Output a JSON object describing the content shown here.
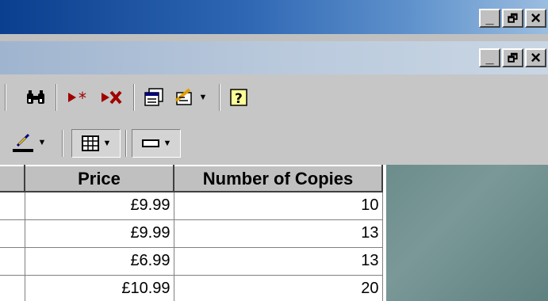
{
  "window": {
    "app_caption": {
      "minimize": "_",
      "restore": "🗗",
      "close": "×"
    },
    "doc_caption": {
      "minimize": "_",
      "restore": "🗗",
      "close": "×"
    }
  },
  "toolbar_standard": {
    "items": [
      {
        "name": "find-icon",
        "glyph": "🔍"
      },
      {
        "name": "new-record-icon",
        "glyph": "▸✱"
      },
      {
        "name": "delete-record-icon",
        "glyph": "▸✕"
      },
      {
        "name": "database-window-icon",
        "glyph": "▦"
      },
      {
        "name": "new-object-icon",
        "glyph": "✎"
      },
      {
        "name": "help-icon",
        "glyph": "?"
      }
    ]
  },
  "toolbar_formatting": {
    "items": [
      {
        "name": "line-color-icon",
        "glyph": "✎"
      },
      {
        "name": "gridlines-icon",
        "glyph": "▦"
      },
      {
        "name": "special-effect-icon",
        "glyph": "▬"
      }
    ]
  },
  "datasheet": {
    "columns": [
      "Price",
      "Number of Copies"
    ],
    "rows": [
      [
        "£9.99",
        "10"
      ],
      [
        "£9.99",
        "13"
      ],
      [
        "£6.99",
        "13"
      ],
      [
        "£10.99",
        "20"
      ]
    ]
  },
  "colors": {
    "title_active": "#0a3e8e",
    "title_inactive": "#9fb4cf",
    "face": "#c0c0c0",
    "desktop": "#6f8f8f"
  }
}
